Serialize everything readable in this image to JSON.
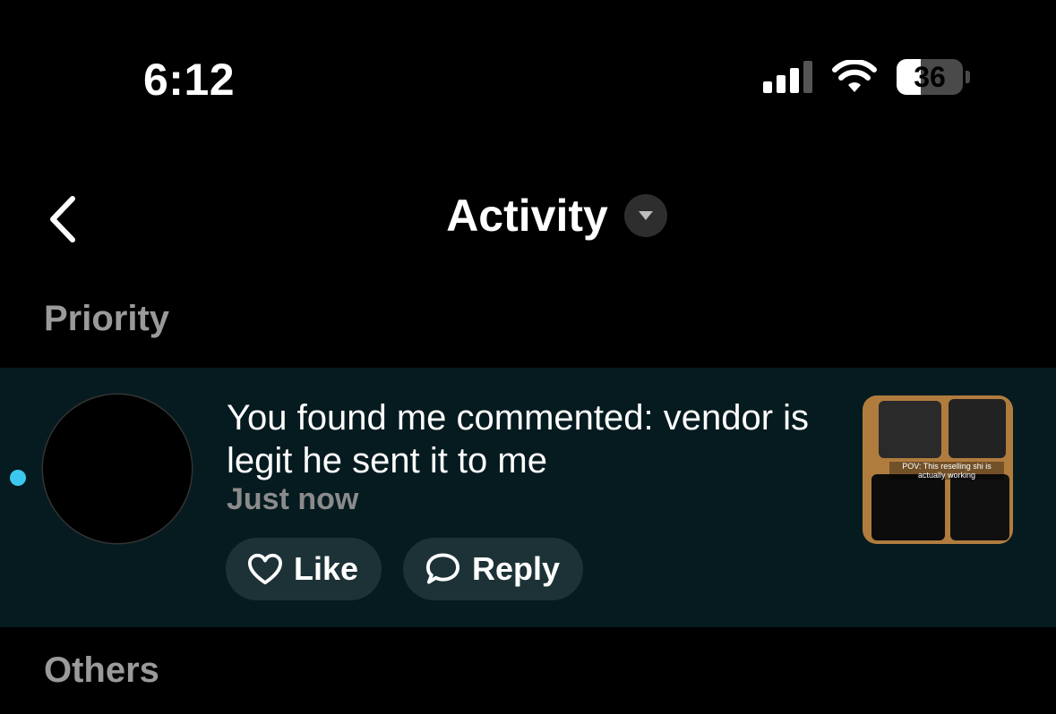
{
  "status_bar": {
    "time": "6:12",
    "battery_level": "36"
  },
  "header": {
    "title": "Activity"
  },
  "sections": {
    "priority": "Priority",
    "others": "Others"
  },
  "notification": {
    "text": "You found me commented: vendor is legit he sent it to me",
    "timestamp": "Just now",
    "like_label": "Like",
    "reply_label": "Reply",
    "thumbnail_caption": "POV: This reselling shi is actually working"
  },
  "colors": {
    "background": "#000000",
    "highlight_row": "#061b1f",
    "unread_dot": "#3cc8ee",
    "button_bg": "#1d3236",
    "muted_text": "#9a9a9a"
  },
  "icons": {
    "back": "chevron-left-icon",
    "dropdown": "caret-down-icon",
    "like": "heart-outline-icon",
    "reply": "speech-bubble-icon"
  }
}
